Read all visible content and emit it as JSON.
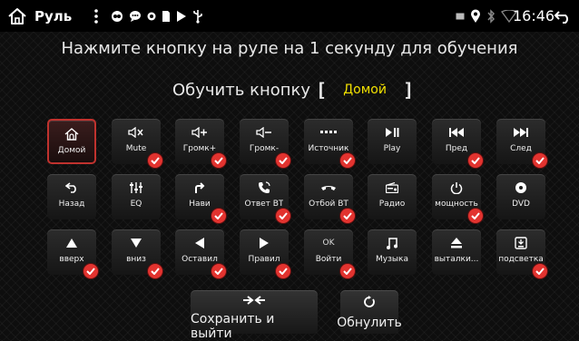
{
  "status_bar": {
    "title": "Руль",
    "clock": "16:46"
  },
  "instruction": "Нажмите кнопку на руле на 1 секунду для обучения",
  "learn": {
    "label": "Обучить кнопку",
    "bracket_open": "[",
    "current": "Домой",
    "bracket_close": "]"
  },
  "keys": [
    {
      "label": "Домой",
      "icon": "home-icon",
      "learned": false,
      "selected": true
    },
    {
      "label": "Mute",
      "icon": "mute-icon",
      "learned": true,
      "selected": false
    },
    {
      "label": "Громк+",
      "icon": "volume-up-icon",
      "learned": true,
      "selected": false
    },
    {
      "label": "Громк-",
      "icon": "volume-down-icon",
      "learned": true,
      "selected": false
    },
    {
      "label": "Источник",
      "icon": "source-icon",
      "learned": true,
      "selected": false
    },
    {
      "label": "Play",
      "icon": "play-pause-icon",
      "learned": false,
      "selected": false
    },
    {
      "label": "Пред",
      "icon": "previous-icon",
      "learned": true,
      "selected": false
    },
    {
      "label": "След",
      "icon": "next-icon",
      "learned": true,
      "selected": false
    },
    {
      "label": "Назад",
      "icon": "back-icon",
      "learned": false,
      "selected": false
    },
    {
      "label": "EQ",
      "icon": "equalizer-icon",
      "learned": false,
      "selected": false
    },
    {
      "label": "Нави",
      "icon": "navigation-icon",
      "learned": true,
      "selected": false
    },
    {
      "label": "Ответ BT",
      "icon": "answer-call-icon",
      "learned": true,
      "selected": false
    },
    {
      "label": "Отбой BT",
      "icon": "hang-up-icon",
      "learned": true,
      "selected": false
    },
    {
      "label": "Радио",
      "icon": "radio-icon",
      "learned": false,
      "selected": false
    },
    {
      "label": "мощность",
      "icon": "power-icon",
      "learned": true,
      "selected": false
    },
    {
      "label": "DVD",
      "icon": "dvd-icon",
      "learned": false,
      "selected": false
    },
    {
      "label": "вверх",
      "icon": "up-arrow-icon",
      "learned": true,
      "selected": false
    },
    {
      "label": "вниз",
      "icon": "down-arrow-icon",
      "learned": true,
      "selected": false
    },
    {
      "label": "Оставил",
      "icon": "left-arrow-icon",
      "learned": true,
      "selected": false
    },
    {
      "label": "Правил",
      "icon": "right-arrow-icon",
      "learned": true,
      "selected": false
    },
    {
      "label": "Войти",
      "icon": "ok-icon",
      "learned": true,
      "selected": false,
      "icon_text": "OK"
    },
    {
      "label": "Музыка",
      "icon": "music-icon",
      "learned": false,
      "selected": false
    },
    {
      "label": "выталки...",
      "icon": "eject-icon",
      "learned": false,
      "selected": false
    },
    {
      "label": "подсветка",
      "icon": "backlight-icon",
      "learned": true,
      "selected": false
    }
  ],
  "buttons": {
    "save": "Сохранить и выйти",
    "reset": "Обнулить"
  },
  "colors": {
    "accent": "#e2332f",
    "highlight": "#f2e000",
    "background": "#0e0e0e"
  }
}
